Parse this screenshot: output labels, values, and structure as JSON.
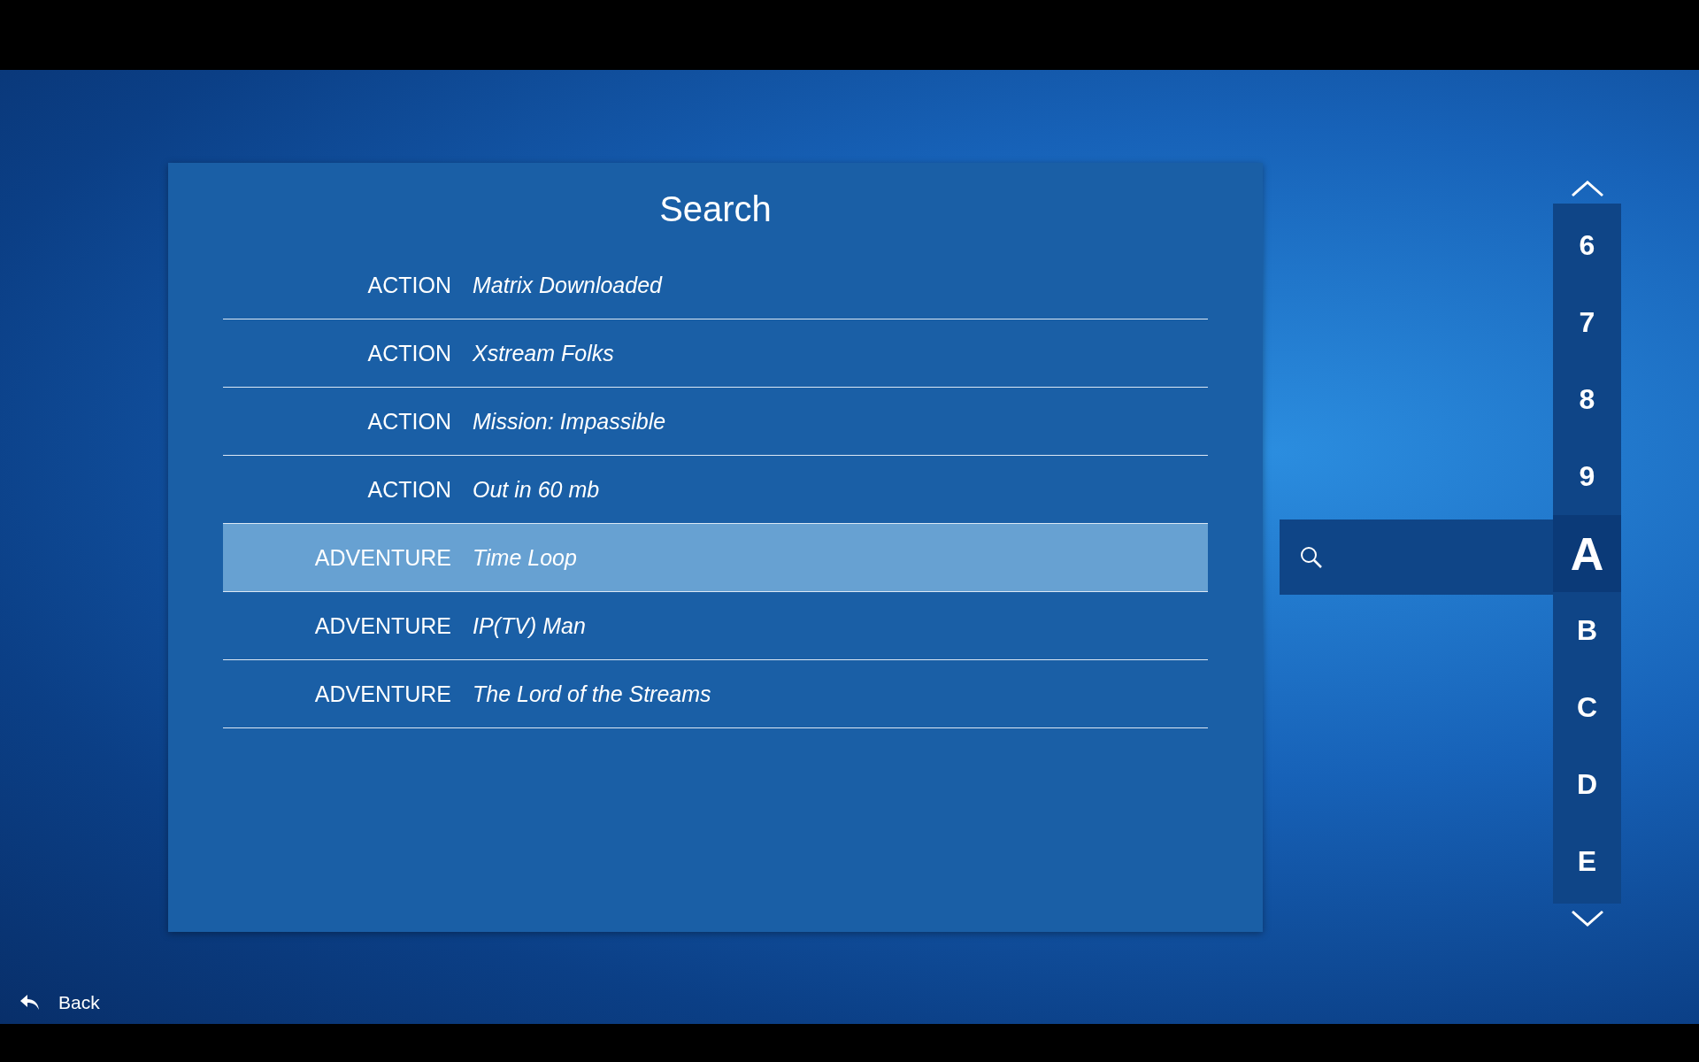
{
  "title": "Search",
  "results": [
    {
      "genre": "ACTION",
      "name": "Matrix Downloaded",
      "selected": false
    },
    {
      "genre": "ACTION",
      "name": "Xstream Folks",
      "selected": false
    },
    {
      "genre": "ACTION",
      "name": "Mission: Impassible",
      "selected": false
    },
    {
      "genre": "ACTION",
      "name": "Out in 60 mb",
      "selected": false
    },
    {
      "genre": "ADVENTURE",
      "name": "Time Loop",
      "selected": true
    },
    {
      "genre": "ADVENTURE",
      "name": "IP(TV) Man",
      "selected": false
    },
    {
      "genre": "ADVENTURE",
      "name": "The Lord of the Streams",
      "selected": false
    }
  ],
  "letters": [
    {
      "label": "6",
      "selected": false
    },
    {
      "label": "7",
      "selected": false
    },
    {
      "label": "8",
      "selected": false
    },
    {
      "label": "9",
      "selected": false
    },
    {
      "label": "A",
      "selected": true
    },
    {
      "label": "B",
      "selected": false
    },
    {
      "label": "C",
      "selected": false
    },
    {
      "label": "D",
      "selected": false
    },
    {
      "label": "E",
      "selected": false
    }
  ],
  "back": "Back"
}
